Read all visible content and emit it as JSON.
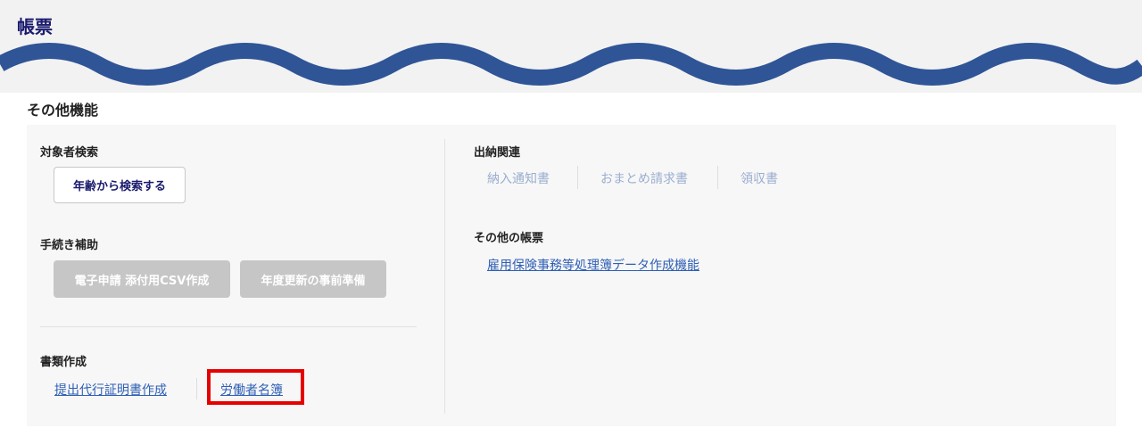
{
  "header": {
    "title": "帳票"
  },
  "section": {
    "title": "その他機能"
  },
  "target_search": {
    "label": "対象者検索",
    "button": "年齢から検索する"
  },
  "procedure_support": {
    "label": "手続き補助",
    "buttons": [
      "電子申請 添付用CSV作成",
      "年度更新の事前準備"
    ]
  },
  "document_creation": {
    "label": "書類作成",
    "links": [
      "提出代行証明書作成",
      "労働者名簿"
    ]
  },
  "payment": {
    "label": "出納関連",
    "links": [
      "納入通知書",
      "おまとめ請求書",
      "領収書"
    ]
  },
  "other_forms": {
    "label": "その他の帳票",
    "links": [
      "雇用保険事務等処理簿データ作成機能"
    ]
  },
  "colors": {
    "wave": "#2f5597",
    "highlight": "#e60000",
    "link": "#2e5fb5",
    "title": "#1a1a6e"
  }
}
